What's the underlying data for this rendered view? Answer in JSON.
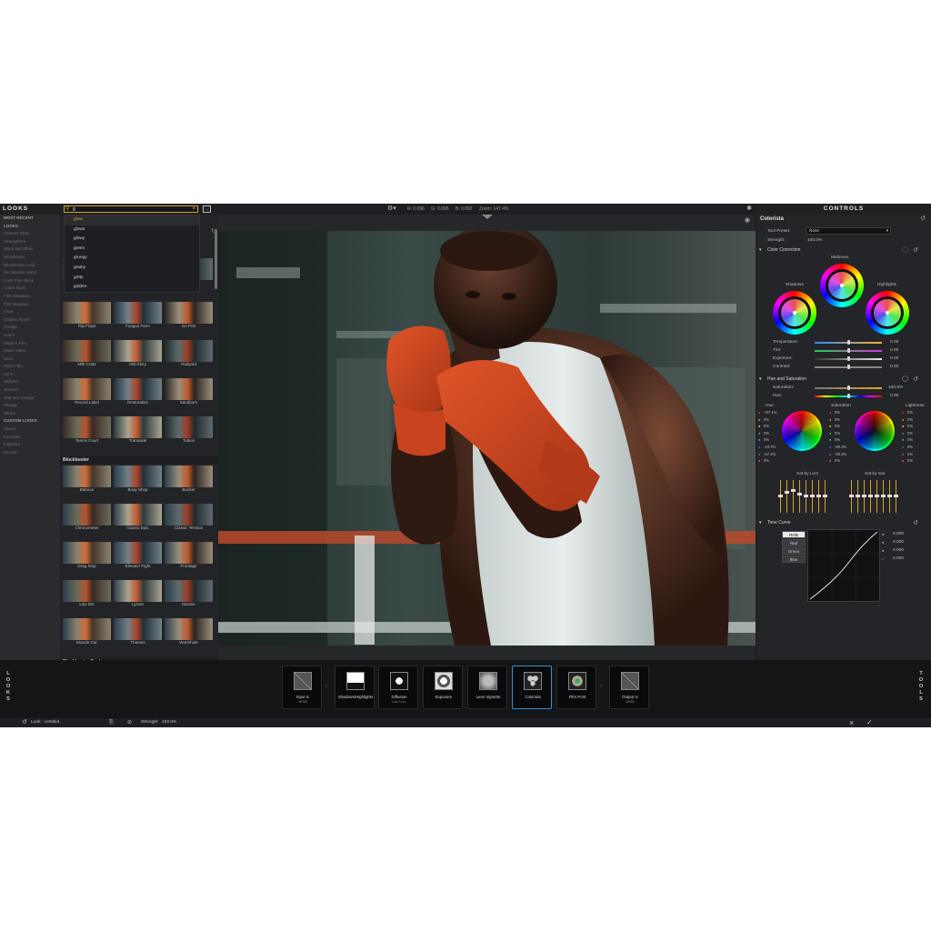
{
  "looks_panel": {
    "title": "LOOKS",
    "categories": [
      "MOST RECENT",
      "LOOKS",
      "Abstract Glow",
      "Atmosphere",
      "Black and White",
      "Blockbuster",
      "Blockbuster Cool",
      "Blockbuster Warm",
      "Color Film Stock",
      "Comic Book",
      "Film Emulation",
      "Film Negative",
      "Glow",
      "Graphic Novel",
      "Grunge",
      "Horror",
      "Modern Film",
      "Music Video",
      "Neon",
      "Retro Film",
      "Sci-Fi",
      "Stylized",
      "Summer",
      "Teal and Orange",
      "Vintage",
      "Winter"
    ],
    "custom_head": "CUSTOM LOOKS",
    "custom_items": [
      "Saved",
      "Favorites",
      "Imported",
      "Recent"
    ]
  },
  "search": {
    "value": "g",
    "clear_icon": "close-icon",
    "suggestions": [
      "glow",
      "glows",
      "glowy",
      "green",
      "grungy",
      "grainy",
      "gritty",
      "golden"
    ]
  },
  "thumbnails": {
    "top_rows": [
      [
        "Flip Flops",
        "Fungus Farm",
        "Ice Pick"
      ],
      [
        "Milk Crate",
        "Old Glory",
        "Railyard"
      ],
      [
        "Record Label",
        "Restoration",
        "Sandborn"
      ],
      [
        "Tennis Court",
        "Transaxle",
        "Tuition"
      ]
    ],
    "section_blockbuster": "Blockbuster",
    "blockbuster_rows": [
      [
        "Batrace",
        "Body Shop",
        "Bunker"
      ],
      [
        "Chronometer",
        "Classic Epic",
        "Classic Tension"
      ],
      [
        "Drag Strip",
        "Elevator Fight",
        "Frontage"
      ],
      [
        "Live Die",
        "Lynxie",
        "Maxine"
      ],
      [
        "Muscle Car",
        "Thames",
        "Wormhole"
      ]
    ],
    "section_blockbuster_cool": "Blockbuster Cool"
  },
  "viewer": {
    "r": "R: 0.096",
    "g": "G: 0.095",
    "b": "B: 0.092",
    "zoom": "Zoom: 147.4%"
  },
  "controls": {
    "title": "CONTROLS",
    "tool": "Colorista",
    "tool_preset_label": "Tool Preset:",
    "tool_preset_value": "None",
    "strength_label": "Strength:",
    "strength_value": "100.0%",
    "color_correction": "Color Correction",
    "wheels": [
      "Shadows",
      "Midtones",
      "Highlights"
    ],
    "sliders": [
      {
        "label": "Temperature:",
        "value": "0.00"
      },
      {
        "label": "Tint:",
        "value": "0.00"
      },
      {
        "label": "Exposure:",
        "value": "0.00"
      },
      {
        "label": "Contrast:",
        "value": "0.00"
      }
    ],
    "hue_sat": "Hue and Saturation",
    "hs_sliders": [
      {
        "label": "Saturation:",
        "value": "100.0%"
      },
      {
        "label": "Hue:",
        "value": "0.00"
      }
    ],
    "hs_cols": [
      "Hue",
      "Saturation",
      "Lightness"
    ],
    "hue_values": [
      "+57.1%",
      "0%",
      "0%",
      "0%",
      "0%",
      "-10.7%",
      "-57.2%",
      "0%"
    ],
    "sat_values": [
      "0%",
      "0%",
      "0%",
      "0%",
      "0%",
      "-80.3%",
      "-80.2%",
      "0%"
    ],
    "light_values": [
      "0%",
      "0%",
      "0%",
      "0%",
      "0%",
      "0%",
      "0%",
      "0%"
    ],
    "sat_by_lum": "Sat by Lum",
    "sat_by_sat": "Sat by Sat",
    "tone_curve": "Tone Curve",
    "tc_channels": [
      "RGB",
      "Red",
      "Green",
      "Blue"
    ],
    "tc_values": [
      "0.000",
      "0.000",
      "0.000",
      "0.000"
    ]
  },
  "pipeline": {
    "left_label": "LOOKS",
    "right_label": "TOOLS",
    "tools": [
      {
        "name": "Input Ic",
        "sub": "sRGB"
      },
      {
        "name": "Shadows/Highlights",
        "sub": ""
      },
      {
        "name": "Diffusion",
        "sub": "Low Curr."
      },
      {
        "name": "Exposure",
        "sub": ""
      },
      {
        "name": "Lens Vignette",
        "sub": ""
      },
      {
        "name": "Colorista",
        "sub": ""
      },
      {
        "name": "Film Print",
        "sub": ""
      },
      {
        "name": "Output Ic",
        "sub": "sRGB"
      }
    ]
  },
  "status": {
    "look_label": "Look:",
    "look_value": "Untitled",
    "strength_label": "Strength:",
    "strength_value": "100.0%"
  },
  "colors": {
    "accent": "#d7a12a",
    "selected": "#3d8ecf"
  }
}
